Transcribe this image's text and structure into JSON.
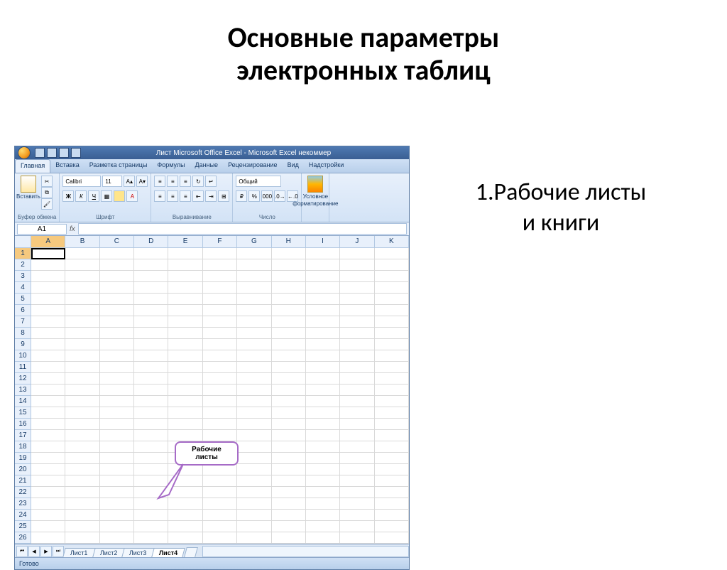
{
  "slide": {
    "title_line1": "Основные параметры",
    "title_line2": "электронных таблиц",
    "side_line1": "1.Рабочие листы",
    "side_line2": "и книги"
  },
  "titlebar": {
    "text": "Лист Microsoft Office Excel - Microsoft Excel некоммер"
  },
  "tabs": {
    "home": "Главная",
    "insert": "Вставка",
    "page_layout": "Разметка страницы",
    "formulas": "Формулы",
    "data": "Данные",
    "review": "Рецензирование",
    "view": "Вид",
    "addins": "Надстройки"
  },
  "ribbon": {
    "clipboard": {
      "paste": "Вставить",
      "label": "Буфер обмена"
    },
    "font": {
      "name": "Calibri",
      "size": "11",
      "label": "Шрифт"
    },
    "alignment": {
      "label": "Выравнивание"
    },
    "number": {
      "format": "Общий",
      "label": "Число"
    },
    "styles": {
      "cond_format_1": "Условное",
      "cond_format_2": "форматирование",
      "label": ""
    }
  },
  "namebox": {
    "value": "A1",
    "fx": "fx"
  },
  "columns": [
    "A",
    "B",
    "C",
    "D",
    "E",
    "F",
    "G",
    "H",
    "I",
    "J",
    "K"
  ],
  "rows": [
    "1",
    "2",
    "3",
    "4",
    "5",
    "6",
    "7",
    "8",
    "9",
    "10",
    "11",
    "12",
    "13",
    "14",
    "15",
    "16",
    "17",
    "18",
    "19",
    "20",
    "21",
    "22",
    "23",
    "24",
    "25",
    "26"
  ],
  "sheet_tabs": {
    "s1": "Лист1",
    "s2": "Лист2",
    "s3": "Лист3",
    "s4": "Лист4"
  },
  "statusbar": {
    "ready": "Готово"
  },
  "callout": {
    "line1": "Рабочие",
    "line2": "листы"
  }
}
